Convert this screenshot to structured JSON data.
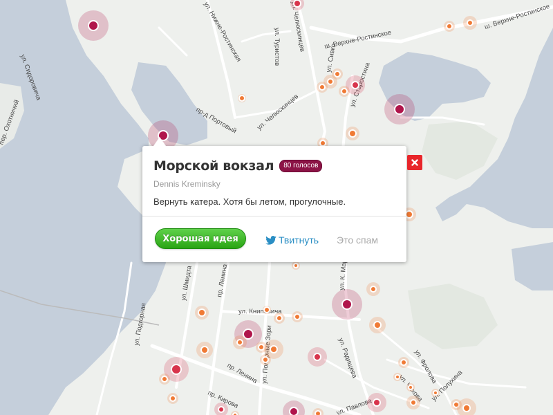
{
  "popup": {
    "title": "Морской вокзал",
    "votes_badge": "80 голосов",
    "author": "Dennis Kreminsky",
    "text": "Вернуть катера. Хотя бы летом, прогулочные.",
    "good_idea_label": "Хорошая идея",
    "tweet_label": "Твитнуть",
    "spam_label": "Это спам"
  },
  "close_icon": "close-icon",
  "colors": {
    "water": "#c5cfdb",
    "land": "#eef0ed",
    "road": "#ffffff",
    "marker_orange": "#f07a35",
    "marker_red": "#d8344c",
    "marker_maroon": "#b0154b",
    "badge": "#8c1446",
    "good_idea_button": "#36ad1e",
    "tweet_link": "#2a8ec4",
    "close_button": "#e8262b"
  },
  "map": {
    "streets": [
      "ул. Нижне-Ростинская",
      "ул. Челюскинцев",
      "ул. Туристов",
      "ш. Верхне-Ростинское",
      "ш. Верхне-Ростинское",
      "ул. Сивко",
      "ул. Старостина",
      "ул. Сидоровича",
      "пер. Охотничий",
      "пр-д Портовый",
      "ул. Челюскинцев",
      "ул. Шмидта",
      "пр. Ленина",
      "ул. К. Маркса",
      "ул. Книповича",
      "ул. Подгорная",
      "ул. Полярные Зори",
      "ул. Радищева",
      "ул. Фролова",
      "пр. Ленина",
      "пр. Кирова",
      "ул. Павлова",
      "ул. Чехова",
      "ул. Полухина"
    ]
  }
}
